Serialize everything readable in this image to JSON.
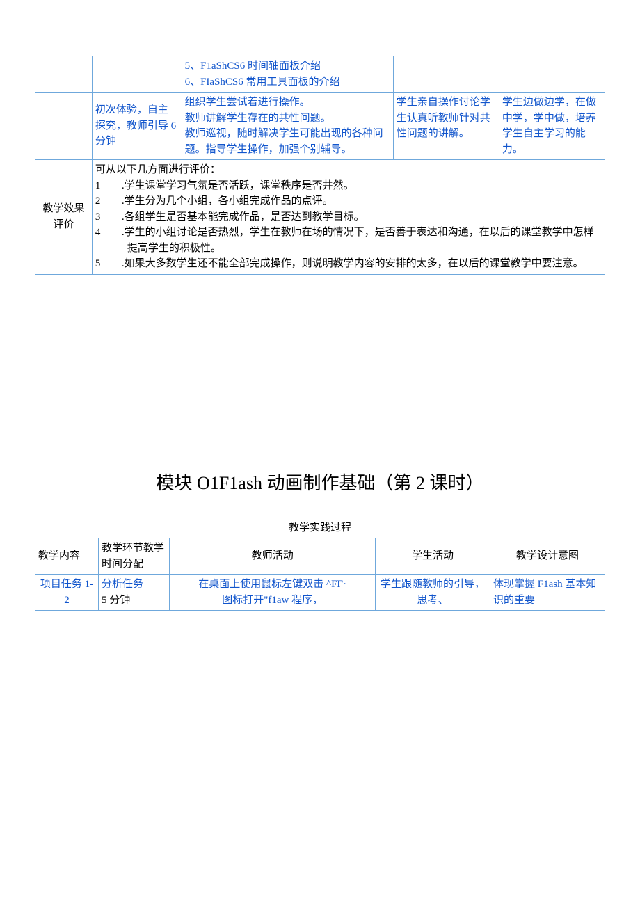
{
  "table1": {
    "row1": {
      "c3_line1": "5、F1aShCS6 时间轴面板介绍",
      "c3_line2": "6、FIaShCS6 常用工具面板的介绍"
    },
    "row2": {
      "c2": "初次体验，自主探究，教师引导 6 分钟",
      "c3_line1": "组织学生尝试着进行操作。",
      "c3_line2": "教师讲解学生存在的共性问题。",
      "c3_line3": "教师巡视，随时解决学生可能出现的各种问题。指导学生操作，加强个别辅导。",
      "c4": "学生亲自操作讨论学生认真听教师针对共性问题的讲解。",
      "c5": "学生边做边学，在做中学，学中做，培养学生自主学习的能力。"
    },
    "row3": {
      "c1": "教学效果评价",
      "intro": "可从以下几方面进行评价：",
      "num1": "1",
      "item1": ".学生课堂学习气氛是否活跃，课堂秩序是否井然。",
      "num2": "2",
      "item2": ".学生分为几个小组，各小组完成作品的点评。",
      "num3": "3",
      "item3": ".各组学生是否基本能完成作品，是否达到教学目标。",
      "num4": "4",
      "item4": ".学生的小组讨论是否热烈，学生在教师在场的情况下，是否善于表达和沟通，在以后的课堂教学中怎样提高学生的积极性。",
      "num5": "5",
      "item5": ".如果大多数学生还不能全部完成操作，则说明教学内容的安排的太多，在以后的课堂教学中要注意。"
    }
  },
  "title": "模块 O1F1ash 动画制作基础（第 2 课时）",
  "table2": {
    "header": "教学实践过程",
    "h1": "教学内容",
    "h2": "教学环节教学时间分配",
    "h3": "教师活动",
    "h4": "学生活动",
    "h5": "教学设计意图",
    "row1": {
      "c1": "项目任务 1-2",
      "c2_line1": "分析任务",
      "c2_line2": "5 分钟",
      "c3_line1": "在桌面上使用鼠标左键双击 ^FΓ·",
      "c3_line2": "图标打开\"f1aw 程序，",
      "c4": "学生跟随教师的引导，思考、",
      "c5": "体现掌握 F1ash 基本知识的重要"
    }
  }
}
